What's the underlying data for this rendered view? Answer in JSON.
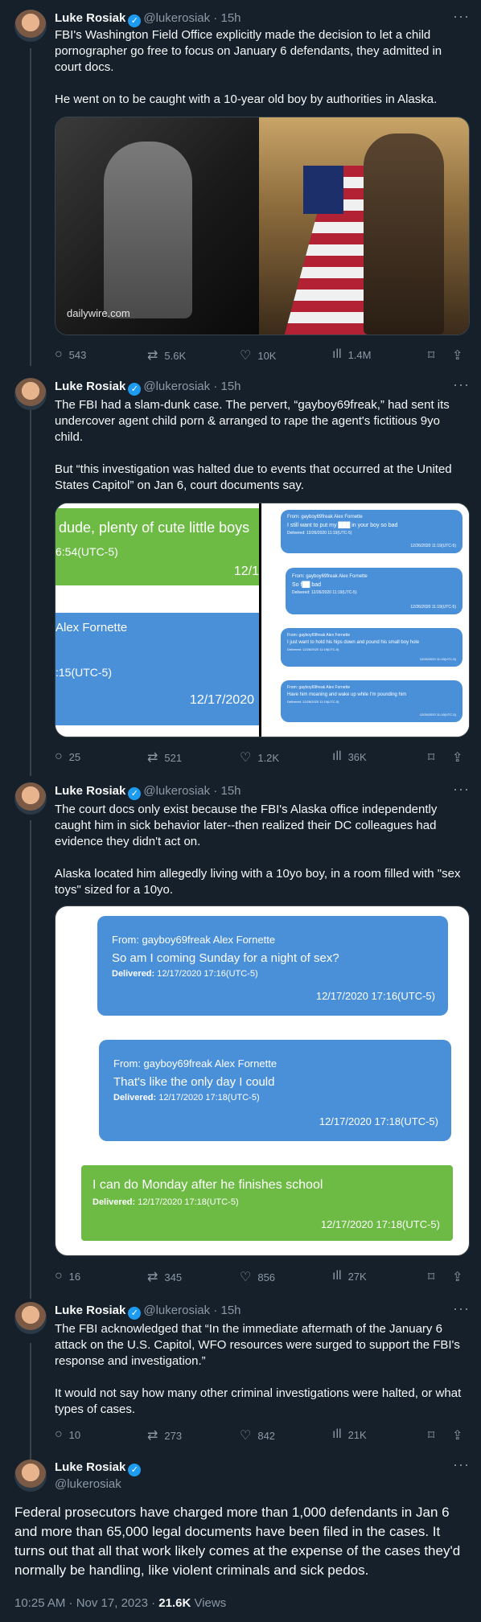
{
  "author": {
    "name": "Luke Rosiak",
    "handle": "@lukerosiak",
    "verified": true
  },
  "tweets": [
    {
      "time": "15h",
      "paragraphs": [
        "FBI's Washington Field Office explicitly made the decision to let a child pornographer go free to focus on January 6 defendants, they admitted in court docs.",
        "He went on to be caught with a 10-year old boy by authorities in Alaska."
      ],
      "media": {
        "watermark": "dailywire.com"
      },
      "stats": {
        "replies": "543",
        "reposts": "5.6K",
        "likes": "10K",
        "views": "1.4M"
      }
    },
    {
      "time": "15h",
      "paragraphs": [
        "The FBI had a slam-dunk case. The pervert, “gayboy69freak,” had sent its undercover agent child porn & arranged to rape the agent's fictitious 9yo child.",
        "But “this investigation was halted due to events that occurred at the United States Capitol” on Jan 6, court documents say."
      ],
      "media": {
        "left": {
          "green_text": "dude, plenty of cute little boys",
          "green_time": "6:54(UTC-5)",
          "green_date": "12/1",
          "blue_from": "Alex Fornette",
          "blue_time": ":15(UTC-5)",
          "blue_date": "12/17/2020"
        },
        "right": [
          {
            "from": "From: gayboy69freak Alex Fornette",
            "msg": "I still want to put my ███ in your boy so bad",
            "delivered": "Delivered: 12/26/2020 11:19(UTC-5)",
            "ts": "12/26/2020 11:19(UTC-5)"
          },
          {
            "from": "From: gayboy69freak Alex Fornette",
            "msg": "So f██ bad",
            "delivered": "Delivered: 12/26/2020 11:19(UTC-5)",
            "ts": "12/26/2020 11:19(UTC-5)"
          },
          {
            "from": "From: gayboy69freak Alex Fornette",
            "msg": "I just want to hold his hips down and pound his small boy hole",
            "delivered": "Delivered: 12/26/2020 11:19(UTC-5)",
            "ts": "12/26/2020 11:19(UTC-5)"
          },
          {
            "from": "From: gayboy69freak Alex Fornette",
            "msg": "Have him moaning and wake up while I'm pounding him",
            "delivered": "Delivered: 12/26/2020 11:19(UTC-5)",
            "ts": "12/26/2020 11:19(UTC-5)"
          }
        ]
      },
      "stats": {
        "replies": "25",
        "reposts": "521",
        "likes": "1.2K",
        "views": "36K"
      }
    },
    {
      "time": "15h",
      "paragraphs": [
        "The court docs only exist because the FBI's Alaska office independently caught him in sick behavior later--then realized their DC colleagues had evidence they didn't act on.",
        "Alaska located him allegedly living with a 10yo boy, in a room filled with \"sex toys\" sized for a 10yo."
      ],
      "media": {
        "messages": [
          {
            "from": "From: gayboy69freak Alex Fornette",
            "msg": "So am I coming Sunday for a night of sex?",
            "delivered_label": "Delivered:",
            "delivered": "12/17/2020 17:16(UTC-5)",
            "ts": "12/17/2020 17:16(UTC-5)"
          },
          {
            "from": "From: gayboy69freak Alex Fornette",
            "msg": "That's like the only day I could",
            "delivered_label": "Delivered:",
            "delivered": "12/17/2020 17:18(UTC-5)",
            "ts": "12/17/2020 17:18(UTC-5)"
          },
          {
            "msg": "I can do Monday after he finishes school",
            "delivered_label": "Delivered:",
            "delivered": "12/17/2020 17:18(UTC-5)",
            "ts": "12/17/2020 17:18(UTC-5)"
          }
        ]
      },
      "stats": {
        "replies": "16",
        "reposts": "345",
        "likes": "856",
        "views": "27K"
      }
    },
    {
      "time": "15h",
      "paragraphs": [
        "The FBI acknowledged that “In the immediate aftermath of the January 6 attack on the U.S. Capitol, WFO resources were surged to support the FBI's response and investigation.”",
        "It would not say how many other criminal investigations were halted, or what types of cases."
      ],
      "stats": {
        "replies": "10",
        "reposts": "273",
        "likes": "842",
        "views": "21K"
      }
    }
  ],
  "final": {
    "text": "Federal prosecutors have charged more than 1,000 defendants in Jan 6 and more than 65,000 legal documents have been filed in the cases. It turns out that all that work likely comes at the expense of the cases they'd normally be handling, like violent criminals and sick pedos.",
    "time": "10:25 AM · Nov 17, 2023 · ",
    "views_count": "21.6K",
    "views_label": " Views"
  },
  "icons": {
    "reply": "reply-icon",
    "repost": "repost-icon",
    "like": "like-icon",
    "views": "views-icon",
    "bookmark": "bookmark-icon",
    "share": "share-icon",
    "more": "more-icon"
  }
}
